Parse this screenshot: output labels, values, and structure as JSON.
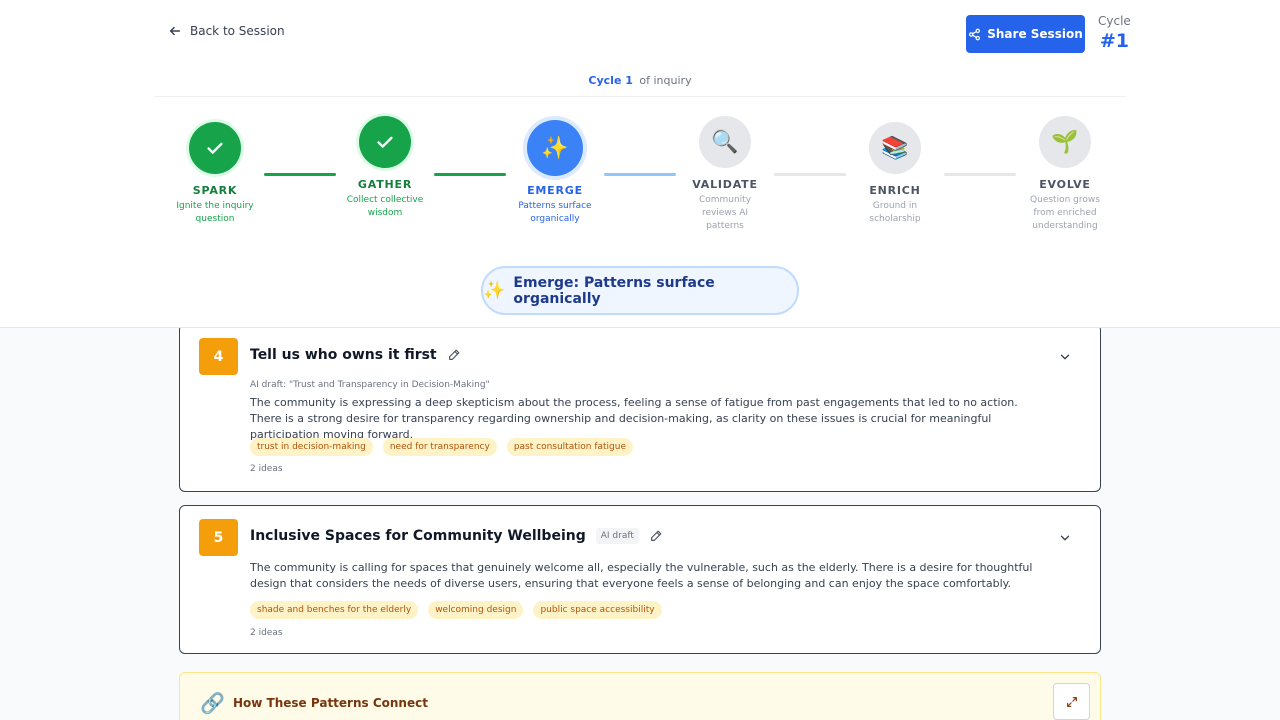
{
  "header": {
    "back_label": "Back to Session",
    "share_label": "Share Session",
    "cycle_label": "Cycle",
    "cycle_number": "#1",
    "cycle_prefix": "Cycle 1",
    "cycle_suffix": "of inquiry"
  },
  "steps": [
    {
      "title": "SPARK",
      "desc": "Ignite the inquiry question",
      "state": "done",
      "icon": "check-icon"
    },
    {
      "title": "GATHER",
      "desc": "Collect collective wisdom",
      "state": "done",
      "icon": "check-icon"
    },
    {
      "title": "EMERGE",
      "desc": "Patterns surface organically",
      "state": "active",
      "icon": "✨"
    },
    {
      "title": "VALIDATE",
      "desc": "Community reviews AI patterns",
      "state": "todo",
      "icon": "🔍"
    },
    {
      "title": "ENRICH",
      "desc": "Ground in scholarship",
      "state": "todo",
      "icon": "📚"
    },
    {
      "title": "EVOLVE",
      "desc": "Question grows from enriched understanding",
      "state": "todo",
      "icon": "🌱"
    }
  ],
  "phase_banner": {
    "icon": "✨",
    "label": "Emerge: Patterns surface organically"
  },
  "patterns": [
    {
      "number": "4",
      "title": "Tell us who owns it first",
      "ai_draft_note": "AI draft: \"Trust and Transparency in Decision-Making\"",
      "body": "The community is expressing a deep skepticism about the process, feeling a sense of fatigue from past engagements that led to no action. There is a strong desire for transparency regarding ownership and decision-making, as clarity on these issues is crucial for meaningful participation moving forward.",
      "tags": [
        "trust in decision-making",
        "need for transparency",
        "past consultation fatigue"
      ],
      "ideas": "2 ideas"
    },
    {
      "number": "5",
      "title": "Inclusive Spaces for Community Wellbeing",
      "ai_chip": "AI draft",
      "body": "The community is calling for spaces that genuinely welcome all, especially the vulnerable, such as the elderly. There is a desire for thoughtful design that considers the needs of diverse users, ensuring that everyone feels a sense of belonging and can enjoy the space comfortably.",
      "tags": [
        "shade and benches for the elderly",
        "welcoming design",
        "public space accessibility"
      ],
      "ideas": "2 ideas"
    }
  ],
  "connections": {
    "icon": "🔗",
    "title": "How These Patterns Connect"
  },
  "colors": {
    "primary": "#2563eb",
    "done": "#16a34a",
    "badge": "#f59e0b",
    "tag_bg": "#fef3c7"
  }
}
